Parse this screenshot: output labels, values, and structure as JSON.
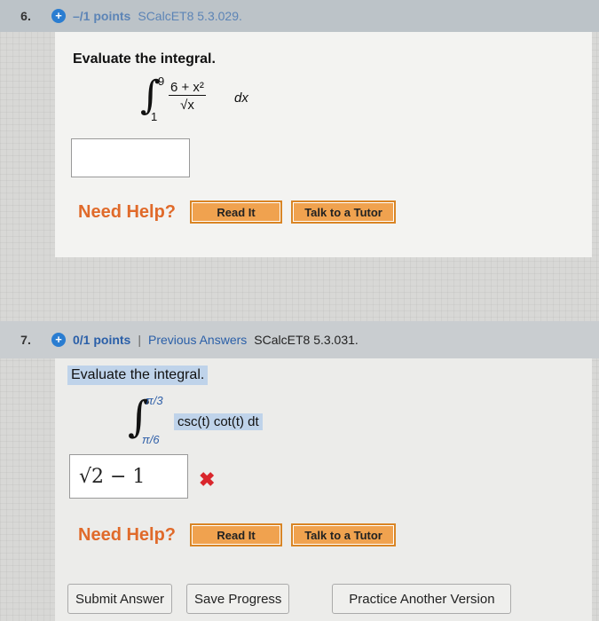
{
  "q6": {
    "number": "6.",
    "points": "–/1 points",
    "source": "SCalcET8 5.3.029.",
    "prompt": "Evaluate the integral.",
    "integral": {
      "upper": "9",
      "lower": "1",
      "numerator": "6 + x²",
      "denominator": "√x",
      "differential": "dx"
    },
    "answer_value": "",
    "need_help": "Need Help?",
    "read_it": "Read It",
    "talk_to_tutor": "Talk to a Tutor"
  },
  "q7": {
    "number": "7.",
    "points": "0/1 points",
    "separator": "|",
    "previous_answers": "Previous Answers",
    "source": "SCalcET8 5.3.031.",
    "prompt": "Evaluate the integral.",
    "integral": {
      "upper": "π/3",
      "lower": "π/6",
      "expression": "csc(t) cot(t) dt"
    },
    "answer_value": "√2 − 1",
    "answer_status": "incorrect",
    "need_help": "Need Help?",
    "read_it": "Read It",
    "talk_to_tutor": "Talk to a Tutor"
  },
  "footer": {
    "submit": "Submit Answer",
    "save": "Save Progress",
    "practice": "Practice Another Version"
  },
  "colors": {
    "link_blue": "#2a5fa8",
    "need_help_orange": "#e06a2a",
    "help_button": "#f0a24f",
    "wrong_red": "#d9262c"
  },
  "icons": {
    "points_icon": "plus-circle-icon",
    "status_icon": "x-mark-icon"
  }
}
